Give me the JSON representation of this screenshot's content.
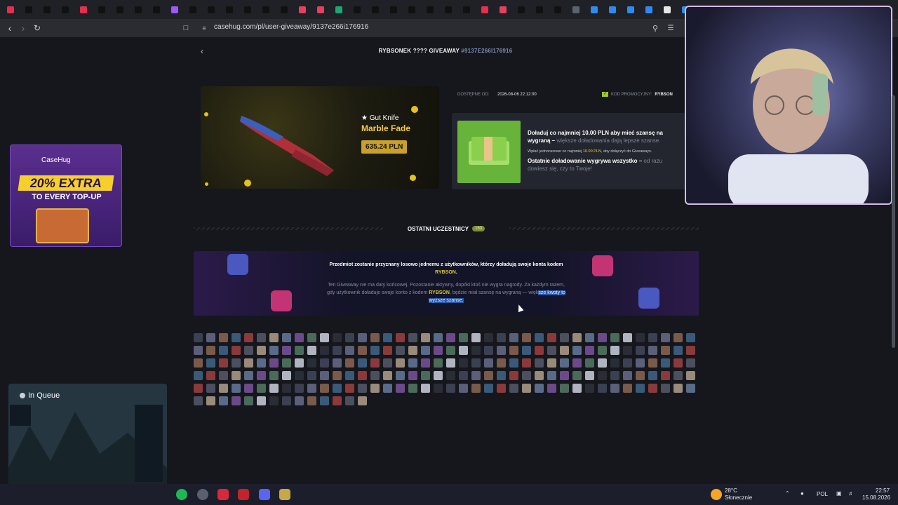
{
  "browser": {
    "url": "casehug.com/pl/user-giveaway/9137e266i176916",
    "tab_colors": [
      "#e62e4d",
      "#111111",
      "#111111",
      "#111111",
      "#e62e4d",
      "#111111",
      "#111111",
      "#111111",
      "#111111",
      "#9b59ff",
      "#111111",
      "#111111",
      "#111111",
      "#111111",
      "#111111",
      "#111111",
      "#e4405f",
      "#e4405f",
      "#1ea672",
      "#111111",
      "#111111",
      "#111111",
      "#111111",
      "#111111",
      "#111111",
      "#111111",
      "#e62e4d",
      "#e4405f",
      "#111111",
      "#111111",
      "#111111",
      "#5b6370",
      "#2f8af0",
      "#2f8af0",
      "#2f8af0",
      "#2f8af0",
      "#e6e6e6",
      "#2f8af0",
      "#ff4500",
      "#ff4500",
      "#3ea85a",
      "#2f8af0",
      "#1ea672",
      "#111111"
    ]
  },
  "giveaway": {
    "title": "RYBSONEK ???? GIVEAWAY",
    "hash": "#9137E266I176916",
    "prize_name_line1": "★ Gut Knife",
    "prize_name_line2": "Marble Fade",
    "prize_price": "635.24 PLN",
    "available_label": "DOSTĘPNE OD:",
    "available_value": "2026-08-06 22:12:00",
    "promo_label": "KOD PROMOCYJNY:",
    "promo_value": "RYBSON",
    "info_bold1": "Doładuj co najmniej 10.00 PLN aby mieć szansę na wygraną –",
    "info_muted1": " większe doładowania dają lepsze szanse.",
    "info_small_pre": "Wpłać jednorazowo co najmniej ",
    "info_small_amount": "10.00 PLN",
    "info_small_post": ", aby dołączyć do Giveaways.",
    "info_bold2": "Ostatnie doładowanie wygrywa wszystko –",
    "info_muted2": " od razu dowiesz się, czy to Twoje!"
  },
  "participants": {
    "section_label": "OSTATNI UCZESTNICY",
    "count": "163",
    "banner_line1_pre": "Przedmiot zostanie przyznany losowo jednemu z użytkowników, którzy doładują swoje konta kodem ",
    "banner_code": "RYBSON",
    "banner_line1_post": ".",
    "banner_line2_pre": "Ten Giveaway nie ma daty końcowej. Pozostanie aktywny, dopóki ktoś nie wygra nagrody. Za każdym razem, gdy użytkownik doładuje swoje konto z kodem ",
    "banner_code2": "RYBSON",
    "banner_line2_mid": ", będzie miał szansę na wygraną — więk",
    "banner_line2_highlight": "sze kwoty to wyższe szanse."
  },
  "side_ad": {
    "brand": "CaseHug",
    "headline": "20% EXTRA",
    "subline": "TO EVERY TOP-UP"
  },
  "stream_preview": {
    "title": "In Queue"
  },
  "taskbar": {
    "weather_temp": "28°C",
    "weather_desc": "Słonecznie",
    "language": "POL",
    "time": "22:57",
    "date": "15.08.2026"
  }
}
